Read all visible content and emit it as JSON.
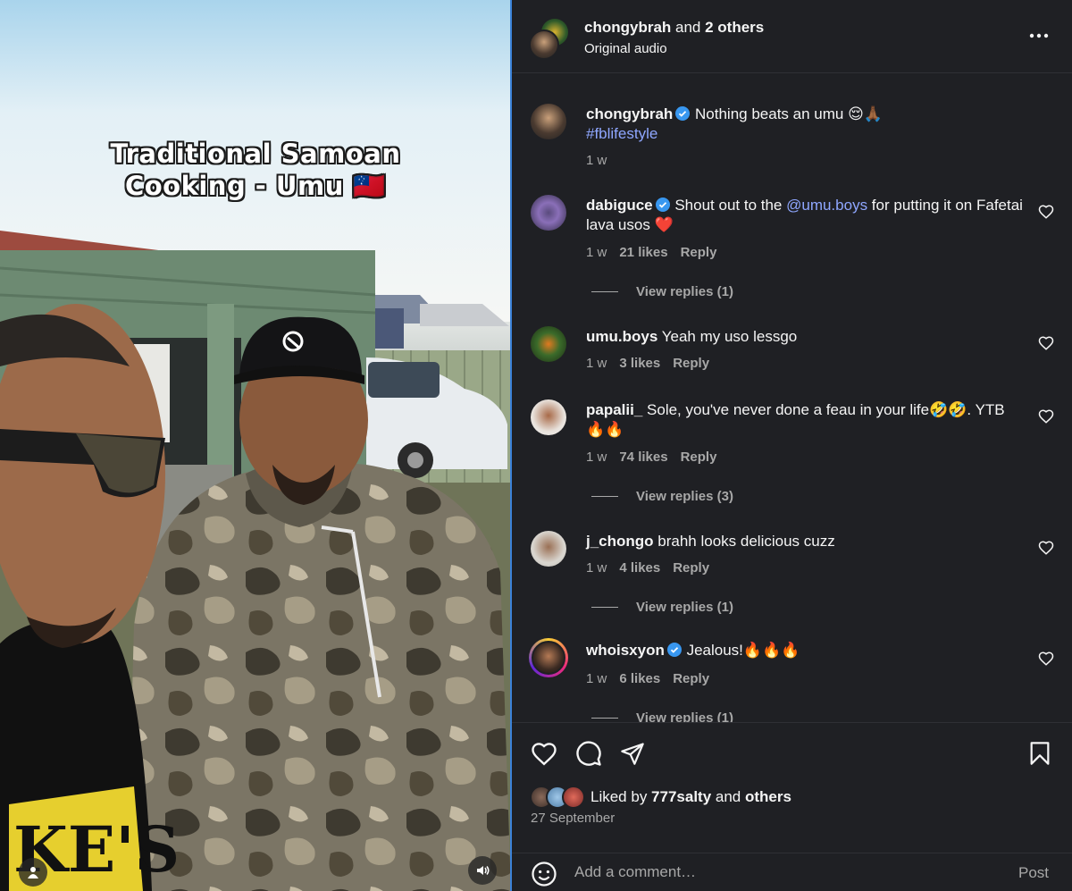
{
  "video": {
    "overlay_line1": "Traditional Samoan",
    "overlay_line2": "Cooking - Umu 🇼🇸",
    "profile_icon": "person-icon",
    "sound_icon": "speaker-icon"
  },
  "header": {
    "username": "chongybrah",
    "connector": " and ",
    "others": "2 others",
    "subtitle": "Original audio",
    "more_icon": "more-horizontal-icon"
  },
  "caption": {
    "user": "chongybrah",
    "verified": true,
    "text": " Nothing beats an umu 😌🙏🏾",
    "hashtag": "#fblifestyle",
    "time": "1 w"
  },
  "comments": [
    {
      "user": "dabiguce",
      "verified": true,
      "text_before": " Shout out to the ",
      "mention": "@umu.boys",
      "text_after": " for putting it on Fafetai lava usos ❤️",
      "time": "1 w",
      "likes": "21 likes",
      "reply": "Reply",
      "view_replies": "View replies (1)"
    },
    {
      "user": "umu.boys",
      "verified": false,
      "text_before": " Yeah my uso lessgo",
      "mention": "",
      "text_after": "",
      "time": "1 w",
      "likes": "3 likes",
      "reply": "Reply",
      "view_replies": ""
    },
    {
      "user": "papalii_",
      "verified": false,
      "text_before": " Sole, you've never done a feau in your life🤣🤣. YTB 🔥🔥",
      "mention": "",
      "text_after": "",
      "time": "1 w",
      "likes": "74 likes",
      "reply": "Reply",
      "view_replies": "View replies (3)"
    },
    {
      "user": "j_chongo",
      "verified": false,
      "text_before": " brahh looks delicious cuzz",
      "mention": "",
      "text_after": "",
      "time": "1 w",
      "likes": "4 likes",
      "reply": "Reply",
      "view_replies": "View replies (1)"
    },
    {
      "user": "whoisxyon",
      "verified": true,
      "text_before": " Jealous!🔥🔥🔥",
      "mention": "",
      "text_after": "",
      "time": "1 w",
      "likes": "6 likes",
      "reply": "Reply",
      "view_replies": "View replies (1)"
    }
  ],
  "actions": {
    "like_icon": "heart-icon",
    "comment_icon": "comment-bubble-icon",
    "share_icon": "send-icon",
    "save_icon": "bookmark-icon",
    "liked_prefix": "Liked by ",
    "liked_user": "777salty",
    "liked_connector": " and ",
    "liked_others": "others",
    "date": "27 September",
    "emoji_icon": "emoji-icon",
    "comment_placeholder": "Add a comment…",
    "post_label": "Post"
  },
  "colors": {
    "panel_bg": "#1f2024",
    "link": "#8fa7ff",
    "verified": "#3897f0",
    "muted": "#a8a8a8",
    "divider": "#3b82d8"
  }
}
